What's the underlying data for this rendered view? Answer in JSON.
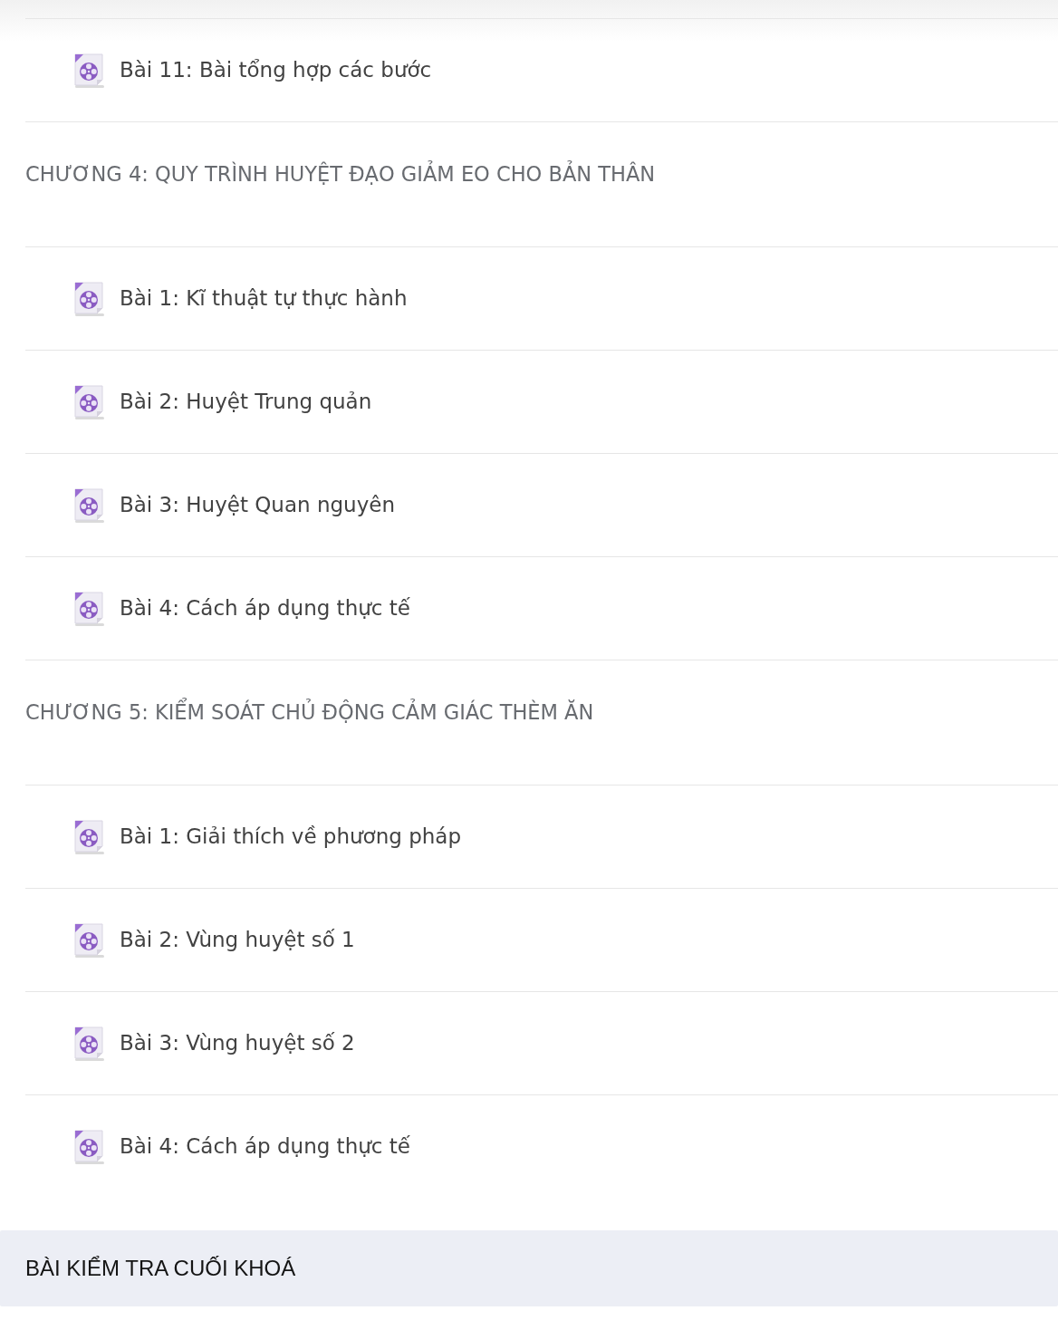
{
  "lessons_continued": [
    {
      "title": "Bài 11: Bài tổng hợp các bước"
    }
  ],
  "chapters": [
    {
      "title": "CHƯƠNG 4: QUY TRÌNH HUYỆT ĐẠO GIẢM EO CHO BẢN THÂN",
      "lessons": [
        {
          "title": "Bài 1: Kĩ thuật tự thực hành"
        },
        {
          "title": "Bài 2: Huyệt Trung quản"
        },
        {
          "title": "Bài 3: Huyệt Quan nguyên"
        },
        {
          "title": "Bài 4: Cách áp dụng thực tế"
        }
      ]
    },
    {
      "title": "CHƯƠNG 5: KIỂM SOÁT CHỦ ĐỘNG CẢM GIÁC THÈM ĂN",
      "lessons": [
        {
          "title": "Bài 1: Giải thích về phương pháp"
        },
        {
          "title": "Bài 2: Vùng huyệt số 1"
        },
        {
          "title": "Bài 3: Vùng huyệt số 2"
        },
        {
          "title": "Bài 4: Cách áp dụng thực tế"
        }
      ]
    }
  ],
  "final_test": {
    "title": "BÀI KIỂM TRA CUỐI KHOÁ"
  }
}
